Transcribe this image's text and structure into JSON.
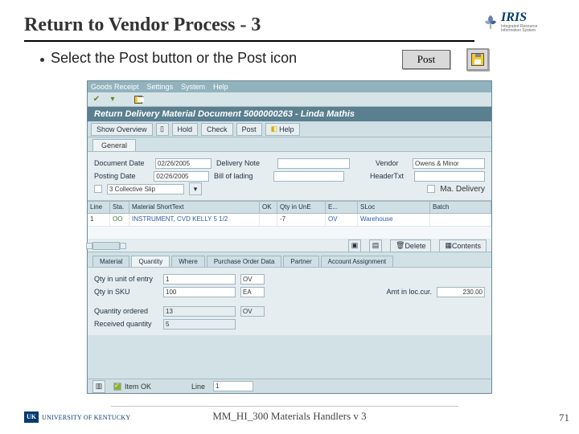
{
  "slide": {
    "title": "Return to Vendor Process - 3",
    "bullet": "Select the Post button or the Post icon",
    "post_label": "Post",
    "footer": "MM_HI_300 Materials Handlers v 3",
    "number": "71",
    "uk_mark": "UK",
    "uk_name": "UNIVERSITY OF KENTUCKY",
    "iris": "IRIS"
  },
  "sap": {
    "menu": [
      "Goods Receipt",
      "Settings",
      "System",
      "Help"
    ],
    "window_title": "Return Delivery Material Document 5000000263 - Linda Mathis",
    "app_toolbar": {
      "show_overview": "Show Overview",
      "hold": "Hold",
      "check": "Check",
      "post": "Post",
      "help": "Help"
    },
    "tab_general": "General",
    "header": {
      "doc_date_label": "Document Date",
      "doc_date": "02/26/2005",
      "post_date_label": "Posting Date",
      "post_date": "02/26/2005",
      "deliv_note_label": "Delivery Note",
      "bill_lading_label": "Bill of lading",
      "vendor_label": "Vendor",
      "vendor": "Owens & Minor",
      "header_txt_label": "HeaderTxt",
      "collective_slip": "3 Collective Slip",
      "ma_delivery": "Ma. Delivery"
    },
    "grid": {
      "cols": [
        "Line",
        "Sta.",
        "Material ShortText",
        "OK",
        "Qty in UnE",
        "E...",
        "SLoc",
        "Batch"
      ],
      "row1": {
        "line": "1",
        "status": "OO",
        "text": "INSTRUMENT, CVD KELLY 5 1/2",
        "qty": "-7",
        "e": "OV",
        "sloc": "Warehouse"
      }
    },
    "item_toolbar": {
      "delete": "Delete",
      "contents": "Contents"
    },
    "detail_tabs": [
      "Material",
      "Quantity",
      "Where",
      "Purchase Order Data",
      "Partner",
      "Account Assignment"
    ],
    "detail": {
      "qty_uoe_label": "Qty in unit of entry",
      "qty_uoe_val": "1",
      "qty_uoe_unit": "OV",
      "qty_sku_label": "Qty in SKU",
      "qty_sku_val": "100",
      "qty_sku_unit": "EA",
      "amt_label": "Amt in loc.cur.",
      "amt_val": "230.00",
      "qty_ord_label": "Quantity ordered",
      "qty_ord_val": "13",
      "qty_ord_unit": "OV",
      "qty_recv_label": "Received quantity",
      "qty_recv_val": "5"
    },
    "status": {
      "item_ok": "Item OK",
      "line_label": "Line",
      "line_val": "1"
    }
  }
}
